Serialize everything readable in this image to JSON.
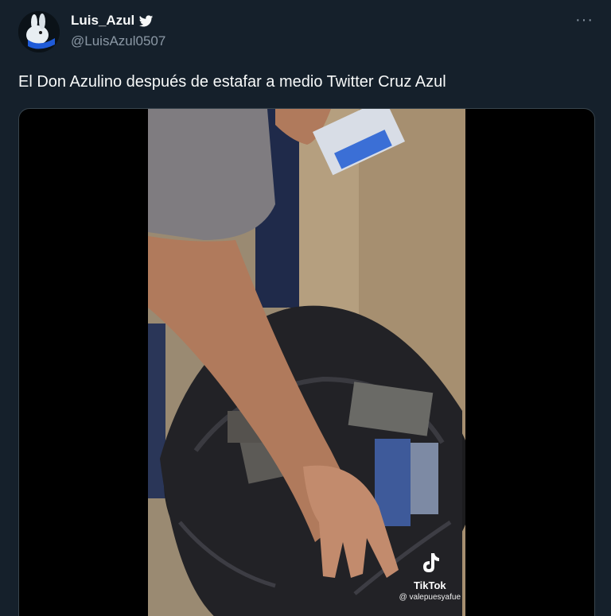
{
  "author": {
    "display_name": "Luis_Azul",
    "handle": "@LuisAzul0507",
    "verified_icon": "twitter-bird-icon"
  },
  "menu": {
    "more_label": "···"
  },
  "tweet": {
    "text": "El Don Azulino después de estafar a medio Twitter Cruz Azul"
  },
  "media": {
    "watermark": {
      "brand": "TikTok",
      "username": "@ valepuesyafue",
      "logo_icon": "tiktok-note-icon"
    }
  },
  "colors": {
    "background": "#15202b",
    "text_primary": "#f7f9f9",
    "text_secondary": "#8b98a5",
    "border": "#38444d",
    "twitter_blue": "#1d9bf0"
  }
}
